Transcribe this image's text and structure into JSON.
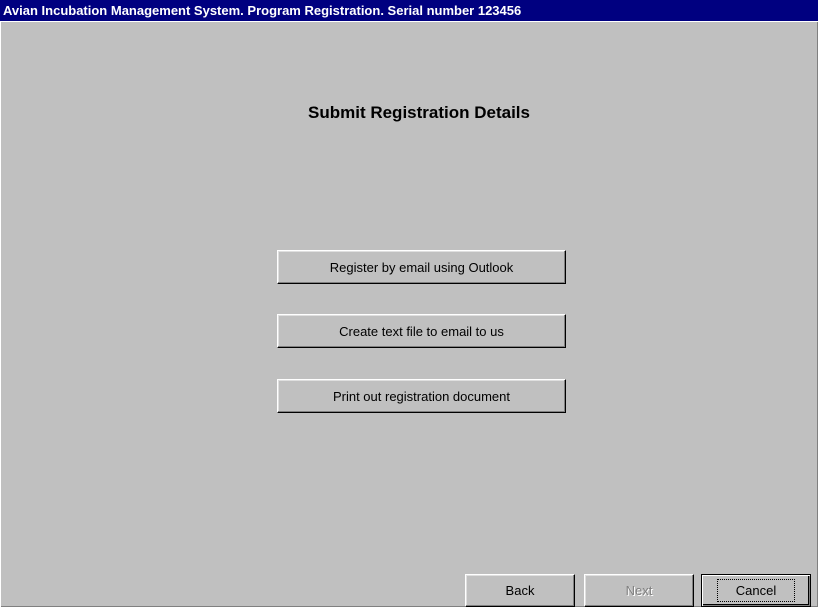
{
  "window": {
    "title": "Avian Incubation Management System.  Program Registration. Serial number 123456"
  },
  "main": {
    "heading": "Submit Registration Details",
    "options": [
      {
        "label": "Register by email using Outlook"
      },
      {
        "label": "Create text file to email to us"
      },
      {
        "label": "Print out registration document"
      }
    ]
  },
  "footer": {
    "back_label": "Back",
    "next_label": "Next",
    "next_enabled": false,
    "cancel_label": "Cancel"
  },
  "colors": {
    "title_bar": "#000080",
    "face": "#c0c0c0",
    "disabled_text": "#808080"
  }
}
